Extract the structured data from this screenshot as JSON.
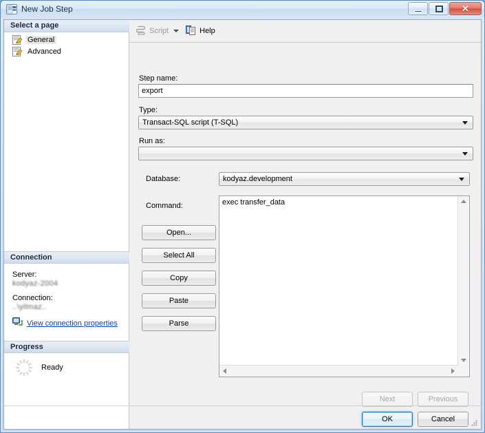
{
  "window": {
    "title": "New Job Step",
    "app_icon": "job-step-icon",
    "controls": {
      "minimize": "minimize-icon",
      "maximize": "restore-icon",
      "close": "✕"
    }
  },
  "sidebar": {
    "select_page_header": "Select a page",
    "pages": [
      {
        "label": "General",
        "icon": "page-general-icon",
        "selected": true
      },
      {
        "label": "Advanced",
        "icon": "page-advanced-icon",
        "selected": false
      }
    ],
    "connection": {
      "header": "Connection",
      "server_label": "Server:",
      "server_value": "kodyaz-2004",
      "connection_label": "Connection:",
      "connection_value": "..\\yilmaz..",
      "link_icon": "connection-properties-icon",
      "link_label": "View connection properties"
    },
    "progress": {
      "header": "Progress",
      "spinner_icon": "progress-spinner-icon",
      "status": "Ready"
    }
  },
  "toolbar": {
    "script_label": "Script",
    "script_icon": "script-icon",
    "script_disabled": true,
    "help_label": "Help",
    "help_icon": "help-icon"
  },
  "form": {
    "step_name_label": "Step name:",
    "step_name_value": "export",
    "step_name_placeholder": "",
    "type_label": "Type:",
    "type_value": "Transact-SQL script (T-SQL)",
    "run_as_label": "Run as:",
    "run_as_value": "",
    "database_label": "Database:",
    "database_value": "kodyaz.development",
    "command_label": "Command:",
    "command_value": "exec transfer_data",
    "side_buttons": [
      {
        "label": "Open...",
        "name": "open-button"
      },
      {
        "label": "Select All",
        "name": "select-all-button"
      },
      {
        "label": "Copy",
        "name": "copy-button"
      },
      {
        "label": "Paste",
        "name": "paste-button"
      },
      {
        "label": "Parse",
        "name": "parse-button"
      }
    ]
  },
  "footer": {
    "next_label": "Next",
    "next_disabled": true,
    "previous_label": "Previous",
    "previous_disabled": true,
    "ok_label": "OK",
    "cancel_label": "Cancel"
  },
  "colors": {
    "accent": "#2a7ab8",
    "link": "#0645ad",
    "close_button": "#cf4f42",
    "window_frame": "#5a84b4"
  }
}
